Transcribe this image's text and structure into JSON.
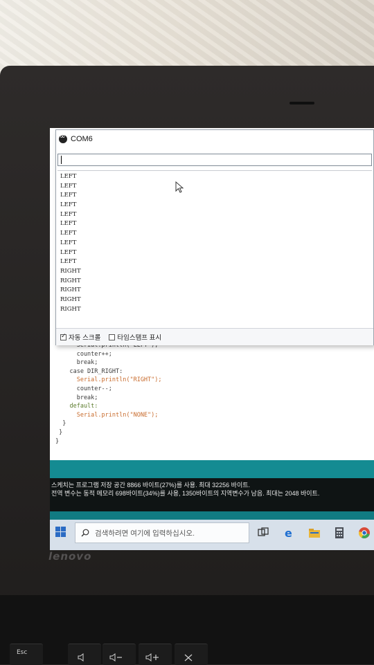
{
  "serial_monitor": {
    "title": "COM6",
    "input_value": "",
    "output_lines": [
      "LEFT",
      "LEFT",
      "LEFT",
      "LEFT",
      "LEFT",
      "LEFT",
      "LEFT",
      "LEFT",
      "LEFT",
      "LEFT",
      "RIGHT",
      "RIGHT",
      "RIGHT",
      "RIGHT",
      "RIGHT"
    ],
    "autoscroll_label": "자동 스크롤",
    "autoscroll_checked": true,
    "timestamp_label": "타임스탬프 표시",
    "timestamp_checked": false
  },
  "editor": {
    "code_lines": [
      "      Serial.println(\"LEFT\");",
      "      counter++;",
      "      break;",
      "    case DIR_RIGHT:",
      "      Serial.println(\"RIGHT\");",
      "      counter--;",
      "      break;",
      "    default:",
      "      Serial.println(\"NONE\");",
      "  }",
      " }",
      "}"
    ]
  },
  "console": {
    "line1": "스케치는 프로그램 저장 공간 8866 바이트(27%)를 사용. 최대 32256 바이트.",
    "line2": "전역 변수는 동적 메모리 698바이트(34%)를 사용, 1350바이트의 지역변수가 남음.  최대는 2048 바이트."
  },
  "taskbar": {
    "search_placeholder": "검색하려면 여기에 입력하십시오.",
    "icons": [
      "windows-start-icon",
      "search-icon",
      "task-view-icon",
      "edge-icon",
      "file-explorer-icon",
      "calculator-icon",
      "chrome-icon"
    ]
  },
  "laptop": {
    "brand": "lenovo",
    "key_esc": "Esc"
  },
  "colors": {
    "ide_teal": "#148b92",
    "console_bg": "#0f1414",
    "taskbar_bg": "#d7e0ea"
  }
}
